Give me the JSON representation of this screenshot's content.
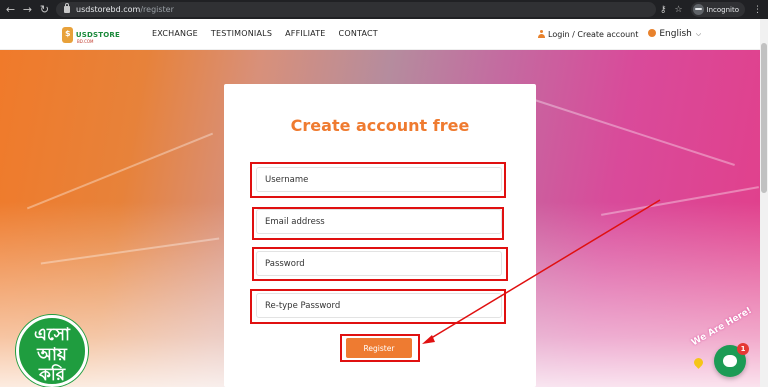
{
  "browser": {
    "url_domain": "usdstorebd.com",
    "url_path": "/register",
    "profile_label": "Incognito"
  },
  "site": {
    "logo_text": "USDSTORE",
    "logo_sub": "BD.COM",
    "menu": [
      "EXCHANGE",
      "TESTIMONIALS",
      "AFFILIATE",
      "CONTACT"
    ],
    "login_link": "Login / Create account",
    "language": "English"
  },
  "form": {
    "title": "Create account free",
    "username_placeholder": "Username",
    "email_placeholder": "Email address",
    "password_placeholder": "Password",
    "retype_placeholder": "Re-type Password",
    "register_label": "Register"
  },
  "badge": {
    "line1": "এসো",
    "line2": "আয়",
    "line3": "করি"
  },
  "chat": {
    "text": "We Are Here!",
    "count": "1"
  },
  "colors": {
    "accent": "#ee7b31",
    "annotation": "#e01010",
    "badge_green": "#1f9d3f"
  }
}
